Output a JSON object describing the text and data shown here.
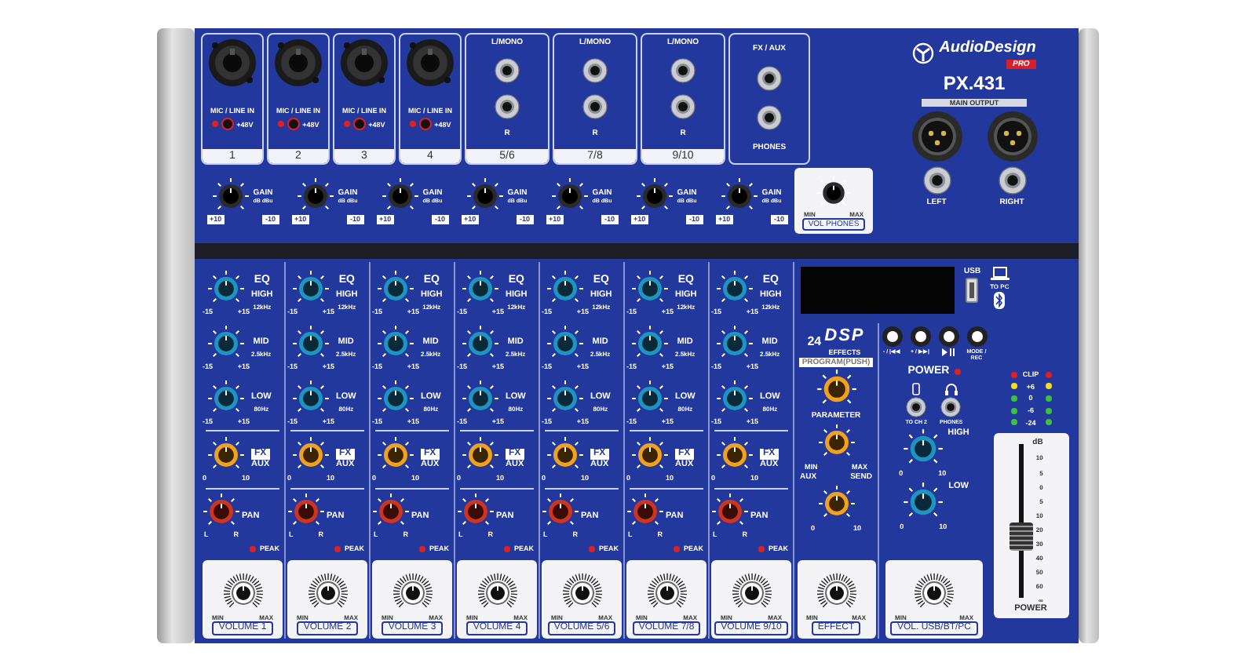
{
  "inputs": [
    {
      "label": "MIC / LINE  IN",
      "phantom": "+48V",
      "number": "1"
    },
    {
      "label": "MIC / LINE  IN",
      "phantom": "+48V",
      "number": "2"
    },
    {
      "label": "MIC / LINE  IN",
      "phantom": "+48V",
      "number": "3"
    },
    {
      "label": "MIC / LINE  IN",
      "phantom": "+48V",
      "number": "4"
    }
  ],
  "stereo_inputs": [
    {
      "top_label": "L/MONO",
      "bottom_label": "R",
      "number": "5/6"
    },
    {
      "top_label": "L/MONO",
      "bottom_label": "R",
      "number": "7/8"
    },
    {
      "top_label": "L/MONO",
      "bottom_label": "R",
      "number": "9/10"
    }
  ],
  "fx_aux": {
    "top_label": "FX / AUX",
    "bottom_label": "PHONES"
  },
  "gains": [
    {
      "label": "GAIN",
      "units": "dB dBu",
      "min": "+10",
      "max": "-10"
    },
    {
      "label": "GAIN",
      "units": "dB dBu",
      "min": "+10",
      "max": "-10"
    },
    {
      "label": "GAIN",
      "units": "dB dBu",
      "min": "+10",
      "max": "-10"
    },
    {
      "label": "GAIN",
      "units": "dB dBu",
      "min": "+10",
      "max": "-10"
    },
    {
      "label": "GAIN",
      "units": "dB dBu",
      "min": "+10",
      "max": "-10"
    },
    {
      "label": "GAIN",
      "units": "dB dBu",
      "min": "+10",
      "max": "-10"
    },
    {
      "label": "GAIN",
      "units": "dB dBu",
      "min": "+10",
      "max": "-10"
    }
  ],
  "vol_phones": {
    "min": "MIN",
    "max": "MAX",
    "label": "VOL PHONES"
  },
  "brand": {
    "name": "AudioDesign",
    "tag": "PRO",
    "model": "PX.431",
    "main_output": "MAIN OUTPUT",
    "outputs": [
      "LEFT",
      "RIGHT"
    ]
  },
  "channels": [
    {
      "eq": "EQ",
      "bands": [
        {
          "name": "HIGH",
          "freq": "12kHz",
          "min": "-15",
          "max": "+15"
        },
        {
          "name": "MID",
          "freq": "2.5kHz",
          "min": "-15",
          "max": "+15"
        },
        {
          "name": "LOW",
          "freq": "80Hz",
          "min": "-15",
          "max": "+15"
        }
      ],
      "fx": "FX",
      "aux": "AUX",
      "aux_min": "0",
      "aux_max": "10",
      "pan": "PAN",
      "pan_l": "L",
      "pan_r": "R",
      "peak": "PEAK",
      "vol_min": "MIN",
      "vol_max": "MAX",
      "volume": "VOLUME 1"
    },
    {
      "eq": "EQ",
      "bands": [
        {
          "name": "HIGH",
          "freq": "12kHz",
          "min": "-15",
          "max": "+15"
        },
        {
          "name": "MID",
          "freq": "2.5kHz",
          "min": "-15",
          "max": "+15"
        },
        {
          "name": "LOW",
          "freq": "80Hz",
          "min": "-15",
          "max": "+15"
        }
      ],
      "fx": "FX",
      "aux": "AUX",
      "aux_min": "0",
      "aux_max": "10",
      "pan": "PAN",
      "pan_l": "L",
      "pan_r": "R",
      "peak": "PEAK",
      "vol_min": "MIN",
      "vol_max": "MAX",
      "volume": "VOLUME 2"
    },
    {
      "eq": "EQ",
      "bands": [
        {
          "name": "HIGH",
          "freq": "12kHz",
          "min": "-15",
          "max": "+15"
        },
        {
          "name": "MID",
          "freq": "2.5kHz",
          "min": "-15",
          "max": "+15"
        },
        {
          "name": "LOW",
          "freq": "80Hz",
          "min": "-15",
          "max": "+15"
        }
      ],
      "fx": "FX",
      "aux": "AUX",
      "aux_min": "0",
      "aux_max": "10",
      "pan": "PAN",
      "pan_l": "L",
      "pan_r": "R",
      "peak": "PEAK",
      "vol_min": "MIN",
      "vol_max": "MAX",
      "volume": "VOLUME 3"
    },
    {
      "eq": "EQ",
      "bands": [
        {
          "name": "HIGH",
          "freq": "12kHz",
          "min": "-15",
          "max": "+15"
        },
        {
          "name": "MID",
          "freq": "2.5kHz",
          "min": "-15",
          "max": "+15"
        },
        {
          "name": "LOW",
          "freq": "80Hz",
          "min": "-15",
          "max": "+15"
        }
      ],
      "fx": "FX",
      "aux": "AUX",
      "aux_min": "0",
      "aux_max": "10",
      "pan": "PAN",
      "pan_l": "L",
      "pan_r": "R",
      "peak": "PEAK",
      "vol_min": "MIN",
      "vol_max": "MAX",
      "volume": "VOLUME 4"
    },
    {
      "eq": "EQ",
      "bands": [
        {
          "name": "HIGH",
          "freq": "12kHz",
          "min": "-15",
          "max": "+15"
        },
        {
          "name": "MID",
          "freq": "2.5kHz",
          "min": "-15",
          "max": "+15"
        },
        {
          "name": "LOW",
          "freq": "80Hz",
          "min": "-15",
          "max": "+15"
        }
      ],
      "fx": "FX",
      "aux": "AUX",
      "aux_min": "0",
      "aux_max": "10",
      "pan": "PAN",
      "pan_l": "L",
      "pan_r": "R",
      "peak": "PEAK",
      "vol_min": "MIN",
      "vol_max": "MAX",
      "volume": "VOLUME 5/6"
    },
    {
      "eq": "EQ",
      "bands": [
        {
          "name": "HIGH",
          "freq": "12kHz",
          "min": "-15",
          "max": "+15"
        },
        {
          "name": "MID",
          "freq": "2.5kHz",
          "min": "-15",
          "max": "+15"
        },
        {
          "name": "LOW",
          "freq": "80Hz",
          "min": "-15",
          "max": "+15"
        }
      ],
      "fx": "FX",
      "aux": "AUX",
      "aux_min": "0",
      "aux_max": "10",
      "pan": "PAN",
      "pan_l": "L",
      "pan_r": "R",
      "peak": "PEAK",
      "vol_min": "MIN",
      "vol_max": "MAX",
      "volume": "VOLUME 7/8"
    },
    {
      "eq": "EQ",
      "bands": [
        {
          "name": "HIGH",
          "freq": "12kHz",
          "min": "-15",
          "max": "+15"
        },
        {
          "name": "MID",
          "freq": "2.5kHz",
          "min": "-15",
          "max": "+15"
        },
        {
          "name": "LOW",
          "freq": "80Hz",
          "min": "-15",
          "max": "+15"
        }
      ],
      "fx": "FX",
      "aux": "AUX",
      "aux_min": "0",
      "aux_max": "10",
      "pan": "PAN",
      "pan_l": "L",
      "pan_r": "R",
      "peak": "PEAK",
      "vol_min": "MIN",
      "vol_max": "MAX",
      "volume": "VOLUME 9/10"
    }
  ],
  "dsp": {
    "count": "24",
    "name": "DSP",
    "effects": "EFFECTS",
    "program": "PROGRAM(PUSH)",
    "parameter": "PARAMETER",
    "param_min": "MIN",
    "param_max": "MAX",
    "aux": "AUX",
    "send": "SEND",
    "send_min": "0",
    "send_max": "10",
    "effect": {
      "min": "MIN",
      "max": "MAX",
      "label": "EFFECT"
    }
  },
  "player": {
    "usb": "USB",
    "to_pc": "TO PC",
    "buttons": [
      {
        "kind": "text",
        "label": "- / |◀◀"
      },
      {
        "kind": "text",
        "label": "+ / ▶▶|"
      },
      {
        "kind": "icon"
      },
      {
        "kind": "text",
        "label": "MODE / REC"
      }
    ],
    "power": "POWER",
    "jacks": [
      "TO CH 2",
      "PHONES"
    ],
    "high": {
      "label": "HIGH",
      "min": "0",
      "max": "10"
    },
    "low": {
      "label": "LOW",
      "min": "0",
      "max": "10"
    },
    "volume": {
      "min": "MIN",
      "max": "MAX",
      "label": "VOL. USB/BT/PC"
    }
  },
  "meter": [
    {
      "label": "CLIP",
      "color": "#e02020"
    },
    {
      "label": "+6",
      "color": "#f2e21a"
    },
    {
      "label": "0",
      "color": "#3cc23c"
    },
    {
      "label": "-6",
      "color": "#3cc23c"
    },
    {
      "label": "-24",
      "color": "#3cc23c"
    }
  ],
  "master_fader": {
    "unit": "dB",
    "scale": [
      "10",
      "5",
      "0",
      "5",
      "10",
      "20",
      "30",
      "40",
      "50",
      "60",
      "∞"
    ],
    "level": 0.4,
    "label": "POWER"
  }
}
